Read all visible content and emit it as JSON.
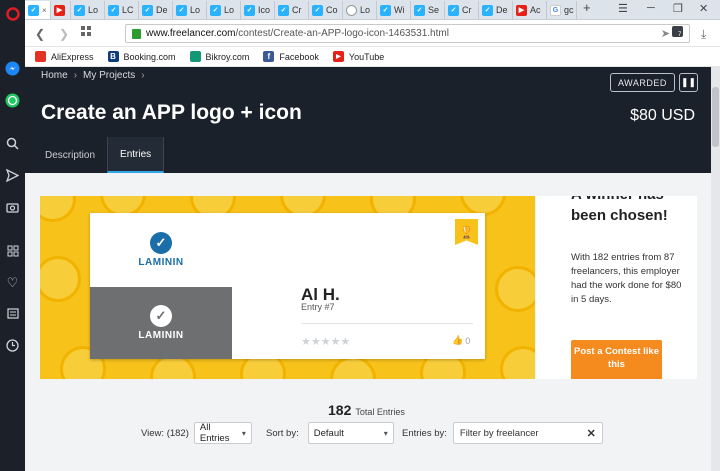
{
  "browser": {
    "tabs": [
      {
        "label": "",
        "icon": "freelancer-favicon",
        "active": true
      },
      {
        "label": "",
        "icon": "youtube-favicon"
      },
      {
        "label": "Lo",
        "icon": "freelancer-favicon"
      },
      {
        "label": "LC",
        "icon": "freelancer-favicon"
      },
      {
        "label": "De",
        "icon": "freelancer-favicon"
      },
      {
        "label": "Lo",
        "icon": "freelancer-favicon"
      },
      {
        "label": "Lo",
        "icon": "freelancer-favicon"
      },
      {
        "label": "Ico",
        "icon": "freelancer-favicon"
      },
      {
        "label": "Cr",
        "icon": "freelancer-favicon"
      },
      {
        "label": "Co",
        "icon": "freelancer-favicon"
      },
      {
        "label": "Lo",
        "icon": "loading-favicon"
      },
      {
        "label": "Wi",
        "icon": "freelancer-favicon"
      },
      {
        "label": "Se",
        "icon": "freelancer-favicon"
      },
      {
        "label": "Cr",
        "icon": "freelancer-favicon"
      },
      {
        "label": "De",
        "icon": "freelancer-favicon"
      },
      {
        "label": "Ac",
        "icon": "youtube-favicon"
      },
      {
        "label": "gc",
        "icon": "google-favicon"
      }
    ],
    "url_host": "www.freelancer.com",
    "url_path": "/contest/Create-an-APP-logo-icon-1463531.html",
    "bookmarks": [
      {
        "label": "AliExpress",
        "icon": "aliexpress-icon",
        "color": "#e43225"
      },
      {
        "label": "Booking.com",
        "icon": "booking-icon",
        "color": "#0c3b7c"
      },
      {
        "label": "Bikroy.com",
        "icon": "bikroy-icon",
        "color": "#149777"
      },
      {
        "label": "Facebook",
        "icon": "facebook-icon",
        "color": "#3b5998"
      },
      {
        "label": "YouTube",
        "icon": "youtube-icon",
        "color": "#e62117"
      }
    ]
  },
  "hero": {
    "breadcrumb": [
      "Home",
      "My Projects"
    ],
    "title": "Create an APP logo + icon",
    "price": "$80 USD",
    "badge": "AWARDED",
    "tabs": [
      "Description",
      "Entries"
    ]
  },
  "entry": {
    "brand": "LAMININ",
    "winner_name": "Al H.",
    "entry_no": "Entry #7",
    "likes": "0"
  },
  "side": {
    "heading": "A winner has been chosen!",
    "text": "With 182 entries from 87 freelancers, this employer had the work done for $80 in 5 days.",
    "cta": "Post a Contest like this"
  },
  "totals": {
    "count": "182",
    "label": "Total Entries"
  },
  "filters": {
    "view_label": "View: (182)",
    "view_value": "All Entries",
    "sort_label": "Sort by:",
    "sort_value": "Default",
    "entries_label": "Entries by:",
    "entries_placeholder": "Filter by freelancer"
  },
  "colors": {
    "hero_bg": "#1b212a",
    "accent_blue": "#2fa5ea",
    "banner_yellow": "#f7c21a",
    "cta_orange": "#f58a1f",
    "brand_blue": "#1a6fa8"
  }
}
